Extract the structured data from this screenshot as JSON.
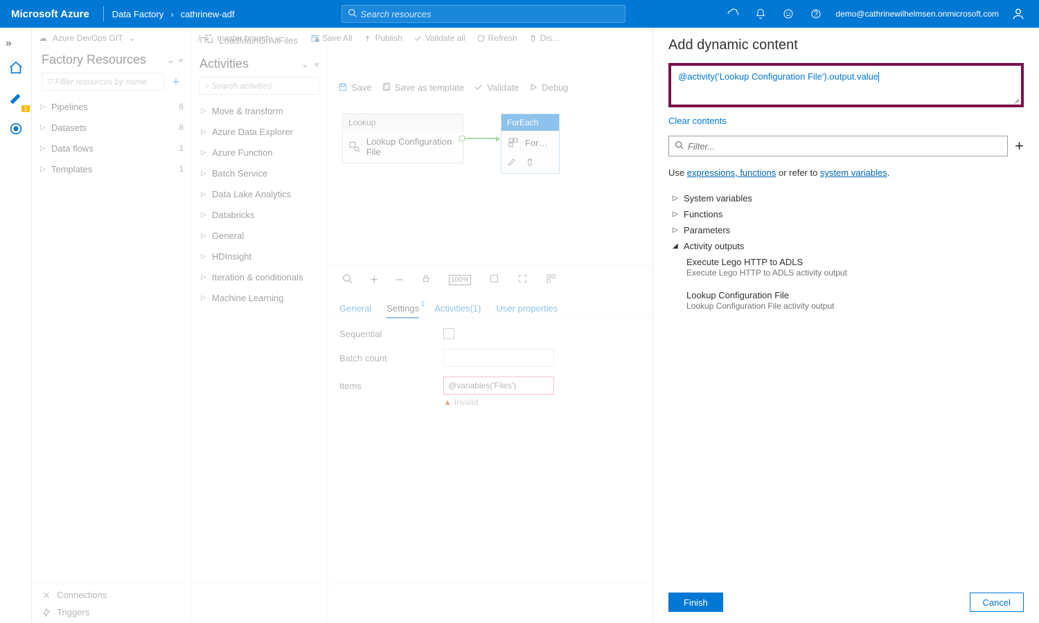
{
  "header": {
    "brand": "Microsoft Azure",
    "crumbService": "Data Factory",
    "crumbResource": "cathrinew-adf",
    "searchPlaceholder": "Search resources",
    "email": "demo@cathrinewilhelmsen.onmicrosoft.com"
  },
  "subtoolbar": {
    "repo": "Azure DevOps GIT",
    "branch": "master branch",
    "saveAll": "Save All",
    "publish": "Publish",
    "validateAll": "Validate all",
    "refresh": "Refresh",
    "discard": "Discard all"
  },
  "rail": {
    "badge": "1"
  },
  "factoryResources": {
    "title": "Factory Resources",
    "filterPlaceholder": "Filter resources by name",
    "items": [
      {
        "label": "Pipelines",
        "count": "6"
      },
      {
        "label": "Datasets",
        "count": "8"
      },
      {
        "label": "Data flows",
        "count": "1"
      },
      {
        "label": "Templates",
        "count": "1"
      }
    ],
    "footerConnections": "Connections",
    "footerTriggers": "Triggers"
  },
  "activities": {
    "tabName": "LoadMainOrAllFiles",
    "title": "Activities",
    "searchPlaceholder": "Search activities",
    "groups": [
      "Move & transform",
      "Azure Data Explorer",
      "Azure Function",
      "Batch Service",
      "Data Lake Analytics",
      "Databricks",
      "General",
      "HDInsight",
      "Iteration & conditionals",
      "Machine Learning"
    ]
  },
  "canvasToolbar": {
    "save": "Save",
    "saveTemplate": "Save as template",
    "validate": "Validate",
    "debug": "Debug"
  },
  "nodes": {
    "lookupType": "Lookup",
    "lookupName": "Lookup Configuration File",
    "foreachType": "ForEach",
    "foreachName": "For Each File"
  },
  "propTabs": {
    "general": "General",
    "settings": "Settings",
    "settingsSup": "1",
    "activities": "Activities(1)",
    "userProps": "User properties"
  },
  "propBody": {
    "sequential": "Sequential",
    "batchCount": "Batch count",
    "items": "Items",
    "itemsValue": "@variables('Files')",
    "invalid": "Invalid"
  },
  "dynamic": {
    "title": "Add dynamic content",
    "expression": "@activity('Lookup Configuration File').output.value",
    "clear": "Clear contents",
    "filterPlaceholder": "Filter...",
    "helpPre": "Use ",
    "helpLink1": "expressions, functions",
    "helpMid": " or refer to ",
    "helpLink2": "system variables",
    "helpPost": ".",
    "sections": [
      "System variables",
      "Functions",
      "Parameters",
      "Activity outputs"
    ],
    "outputs": [
      {
        "title": "Execute Lego HTTP to ADLS",
        "desc": "Execute Lego HTTP to ADLS activity output"
      },
      {
        "title": "Lookup Configuration File",
        "desc": "Lookup Configuration File activity output"
      }
    ],
    "finish": "Finish",
    "cancel": "Cancel"
  }
}
